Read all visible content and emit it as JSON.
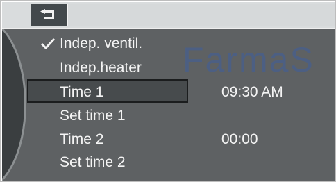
{
  "header": {
    "back_icon": "back-arrow-icon"
  },
  "watermark": "FarmaS",
  "menu": {
    "items": [
      {
        "label": "Indep. ventil.",
        "value": "",
        "checked": true
      },
      {
        "label": "Indep.heater",
        "value": "",
        "checked": false
      },
      {
        "label": "Time 1",
        "value": "09:30 AM",
        "checked": false,
        "selected": true
      },
      {
        "label": "Set time 1",
        "value": "",
        "checked": false
      },
      {
        "label": "Time 2",
        "value": "00:00",
        "checked": false
      },
      {
        "label": "Set time 2",
        "value": "",
        "checked": false
      }
    ]
  },
  "colors": {
    "background": "#5e6163",
    "top_bar": "#d9dcdd",
    "back_tab": "#43494c",
    "text": "#f4f4f4",
    "watermark": "#3f5f9e"
  }
}
